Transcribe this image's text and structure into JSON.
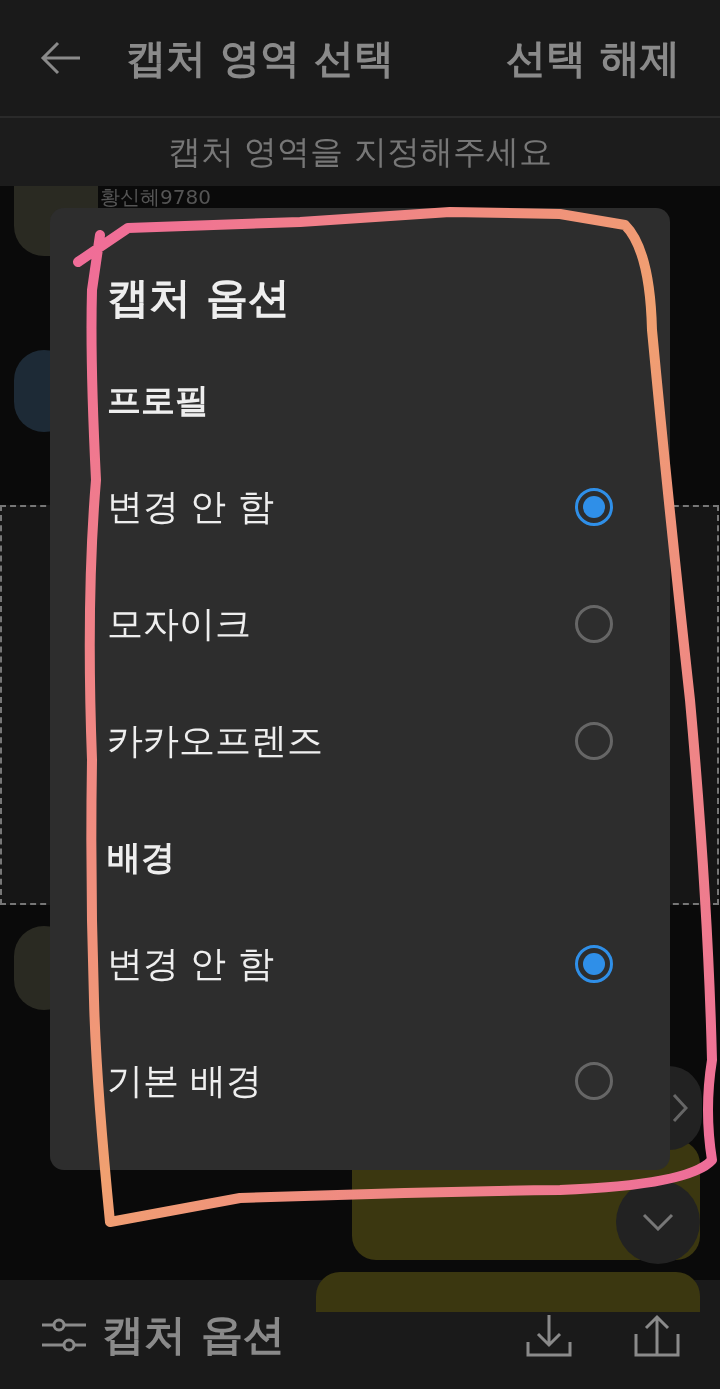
{
  "header": {
    "title": "캡처 영역 선택",
    "action": "선택 해제"
  },
  "subtitle": "캡처 영역을 지정해주세요",
  "chat": {
    "sender": "황신혜9780"
  },
  "dialog": {
    "title": "캡처 옵션",
    "sections": [
      {
        "heading": "프로필",
        "options": [
          {
            "label": "변경 안 함",
            "selected": true
          },
          {
            "label": "모자이크",
            "selected": false
          },
          {
            "label": "카카오프렌즈",
            "selected": false
          }
        ]
      },
      {
        "heading": "배경",
        "options": [
          {
            "label": "변경 안 함",
            "selected": true
          },
          {
            "label": "기본 배경",
            "selected": false
          }
        ]
      }
    ]
  },
  "bottom_bar": {
    "label": "캡처 옵션"
  }
}
